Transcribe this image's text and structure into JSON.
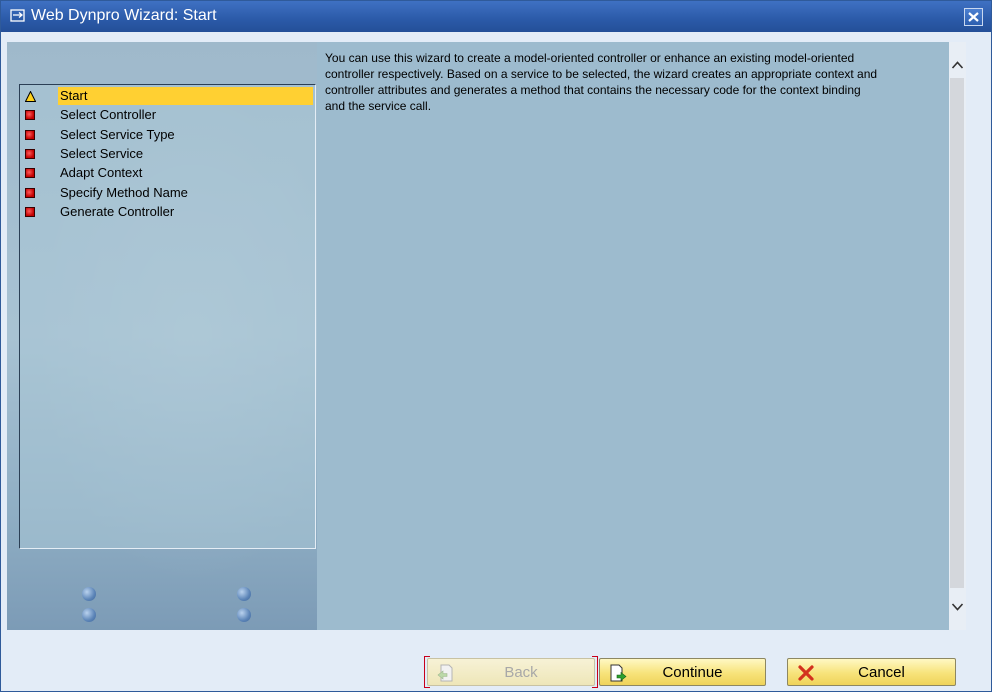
{
  "window": {
    "title": "Web Dynpro Wizard: Start"
  },
  "roadmap": {
    "steps": [
      {
        "label": "Start",
        "status": "active",
        "icon": "warning-triangle-icon"
      },
      {
        "label": "Select Controller",
        "status": "pending",
        "icon": "red-bullet-icon"
      },
      {
        "label": "Select Service Type",
        "status": "pending",
        "icon": "red-bullet-icon"
      },
      {
        "label": "Select Service",
        "status": "pending",
        "icon": "red-bullet-icon"
      },
      {
        "label": "Adapt Context",
        "status": "pending",
        "icon": "red-bullet-icon"
      },
      {
        "label": "Specify Method Name",
        "status": "pending",
        "icon": "red-bullet-icon"
      },
      {
        "label": "Generate Controller",
        "status": "pending",
        "icon": "red-bullet-icon"
      }
    ]
  },
  "content": {
    "lines": [
      "You can use this wizard to create a model-oriented controller or enhance an existing model-oriented",
      "controller respectively. Based on a service to be selected, the wizard creates an appropriate context and",
      "controller attributes and generates a method that contains the necessary code for the context binding",
      "and the service call."
    ]
  },
  "buttons": {
    "back": {
      "label": "Back",
      "enabled": false
    },
    "continue": {
      "label": "Continue"
    },
    "cancel": {
      "label": "Cancel"
    }
  },
  "colors": {
    "titlebar": "#2b5aa8",
    "active_step": "#ffd032",
    "content_bg": "#9dbbce",
    "button": "#f7e37a"
  }
}
